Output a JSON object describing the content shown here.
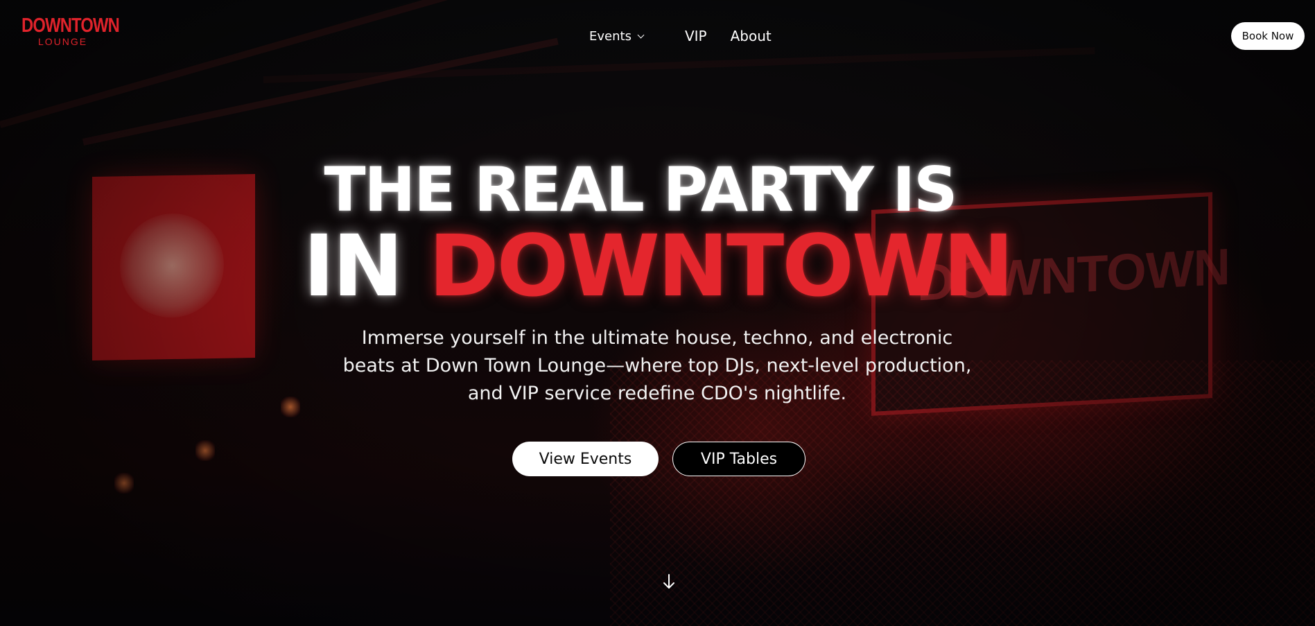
{
  "brand": {
    "logo_top": "DOWNTOWN",
    "logo_bottom": "LOUNGE",
    "accent_color": "#e0232b"
  },
  "nav": {
    "items": [
      {
        "label": "Events",
        "has_dropdown": true
      },
      {
        "label": "VIP"
      },
      {
        "label": "About"
      }
    ],
    "book_label": "Book Now"
  },
  "hero": {
    "headline_line1": "THE REAL PARTY IS",
    "headline_line2_white": "IN",
    "headline_line2_red": "DOWNTOWN",
    "subtitle_lines": [
      "Immerse yourself in the ultimate house, techno, and electronic",
      "beats at Down Town Lounge—where top DJs, next-level production,",
      "and VIP service redefine CDO's nightlife."
    ],
    "cta_primary": "View Events",
    "cta_secondary": "VIP Tables",
    "scroll_icon": "arrow-down-icon"
  }
}
